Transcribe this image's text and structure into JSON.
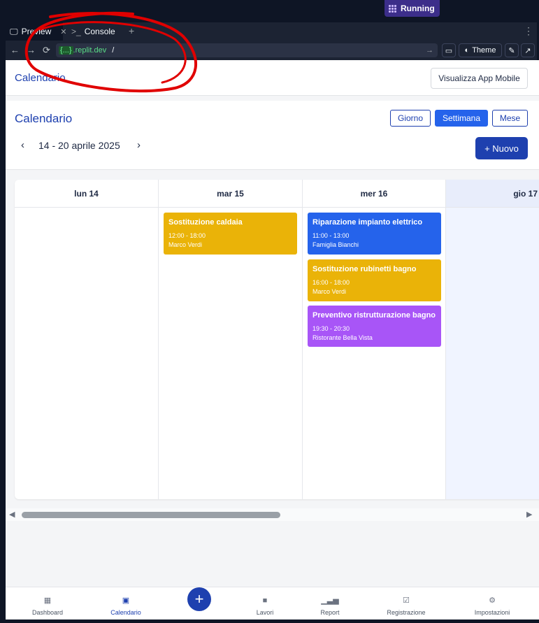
{
  "workspace": {
    "status": "Running",
    "tabs": [
      {
        "label": "Preview",
        "icon": "monitor-icon"
      },
      {
        "label": "Console",
        "icon": "terminal-icon"
      }
    ],
    "url_host_prefix": "{...}",
    "url_host": ".replit.dev",
    "url_path": "/",
    "theme_label": "Theme"
  },
  "app": {
    "brand": "Calendario",
    "mobile_button": "Visualizza App Mobile",
    "calendar": {
      "title": "Calendario",
      "views": [
        "Giorno",
        "Settimana",
        "Mese"
      ],
      "active_view": "Settimana",
      "range": "14 - 20 aprile 2025",
      "new_button": "+ Nuovo",
      "days": [
        {
          "label": "lun 14",
          "events": []
        },
        {
          "label": "mar 15",
          "events": [
            {
              "title": "Sostituzione caldaia",
              "time": "12:00 - 18:00",
              "who": "Marco Verdi",
              "color": "#eab308"
            }
          ]
        },
        {
          "label": "mer 16",
          "events": [
            {
              "title": "Riparazione impianto elettrico",
              "time": "11:00 - 13:00",
              "who": "Famiglia Bianchi",
              "color": "#2563eb"
            },
            {
              "title": "Sostituzione rubinetti bagno",
              "time": "16:00 - 18:00",
              "who": "Marco Verdi",
              "color": "#eab308"
            },
            {
              "title": "Preventivo ristrutturazione bagno",
              "time": "19:30 - 20:30",
              "who": "Ristorante Bella Vista",
              "color": "#a855f7"
            }
          ]
        },
        {
          "label": "gio 17",
          "events": []
        }
      ]
    },
    "bottom_nav": [
      {
        "label": "Dashboard",
        "icon": "dashboard-icon"
      },
      {
        "label": "Calendario",
        "icon": "calendar-icon",
        "active": true
      },
      {
        "label": "Lavori",
        "icon": "briefcase-icon"
      },
      {
        "label": "Report",
        "icon": "bar-chart-icon"
      },
      {
        "label": "Registrazione",
        "icon": "checkbox-icon"
      },
      {
        "label": "Impostazioni",
        "icon": "gear-icon"
      }
    ]
  },
  "colors": {
    "accent": "#1e40af",
    "annotation": "#e00000"
  }
}
